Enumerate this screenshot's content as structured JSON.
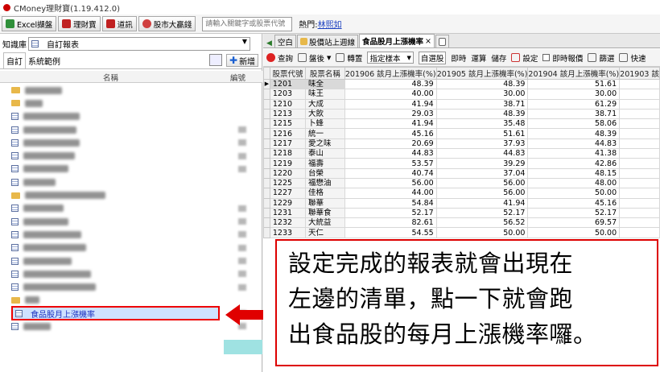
{
  "window": {
    "title": "CMoney理財寶(1.19.412.0)"
  },
  "toolbar": {
    "buttons": [
      {
        "label": "Excel擷盤",
        "icon": "excel-icon",
        "color": "#2f8f3a"
      },
      {
        "label": "理財寶",
        "icon": "cmoney-icon",
        "color": "#c02020"
      },
      {
        "label": "道訊",
        "icon": "news-icon",
        "color": "#c02020"
      },
      {
        "label": "股市大贏錢",
        "icon": "coin-icon",
        "color": "#d04040"
      }
    ],
    "search_placeholder": "請輸入關鍵字或股票代號",
    "hot_label": "熱門:",
    "hot_link": "林熙如"
  },
  "left_panel": {
    "kb_label": "知識庫",
    "kb_selected": "自訂報表",
    "tabs": [
      "自訂",
      "系統範例"
    ],
    "add_label": "新增",
    "col_name": "名稱",
    "col_id": "編號",
    "selected_item": "食品股月上漲機率"
  },
  "right_panel": {
    "tabs": [
      {
        "label": "空白",
        "active": false
      },
      {
        "label": "股價站上週線",
        "active": false
      },
      {
        "label": "食品股月上漲機率",
        "active": true
      },
      {
        "label": "",
        "active": false
      }
    ],
    "toolbar": {
      "query": "查詢",
      "layout": "盤後",
      "rotate": "轉置",
      "sample_select": "指定樣本",
      "custom_pick": "自選股",
      "realtime": "即時",
      "calc": "運算",
      "save": "儲存",
      "settings": "設定",
      "realtime_report": "即時報價",
      "filter": "篩選",
      "quick": "快速"
    },
    "table": {
      "headers": [
        "股票代號",
        "股票名稱",
        "201906 該月上漲機率(%)",
        "201905 該月上漲機率(%)",
        "201904 該月上漲機率(%)",
        "201903 該"
      ],
      "rows": [
        [
          "1201",
          "味全",
          "48.39",
          "48.39",
          "51.61",
          ""
        ],
        [
          "1203",
          "味王",
          "40.00",
          "30.00",
          "30.00",
          ""
        ],
        [
          "1210",
          "大成",
          "41.94",
          "38.71",
          "61.29",
          ""
        ],
        [
          "1213",
          "大飲",
          "29.03",
          "48.39",
          "38.71",
          ""
        ],
        [
          "1215",
          "卜蜂",
          "41.94",
          "35.48",
          "58.06",
          ""
        ],
        [
          "1216",
          "統一",
          "45.16",
          "51.61",
          "48.39",
          ""
        ],
        [
          "1217",
          "愛之味",
          "20.69",
          "37.93",
          "44.83",
          ""
        ],
        [
          "1218",
          "泰山",
          "44.83",
          "44.83",
          "41.38",
          ""
        ],
        [
          "1219",
          "福壽",
          "53.57",
          "39.29",
          "42.86",
          ""
        ],
        [
          "1220",
          "台榮",
          "40.74",
          "37.04",
          "48.15",
          ""
        ],
        [
          "1225",
          "福懋油",
          "56.00",
          "56.00",
          "48.00",
          ""
        ],
        [
          "1227",
          "佳格",
          "44.00",
          "56.00",
          "50.00",
          ""
        ],
        [
          "1229",
          "聯華",
          "54.84",
          "41.94",
          "45.16",
          ""
        ],
        [
          "1231",
          "聯華食",
          "52.17",
          "52.17",
          "52.17",
          ""
        ],
        [
          "1232",
          "大統益",
          "82.61",
          "56.52",
          "69.57",
          ""
        ],
        [
          "1233",
          "天仁",
          "54.55",
          "50.00",
          "50.00",
          ""
        ]
      ]
    }
  },
  "callout": {
    "lines": [
      "設定完成的報表就會出現在",
      "左邊的清單，點一下就會跑",
      "出食品股的每月上漲機率囉。"
    ]
  }
}
